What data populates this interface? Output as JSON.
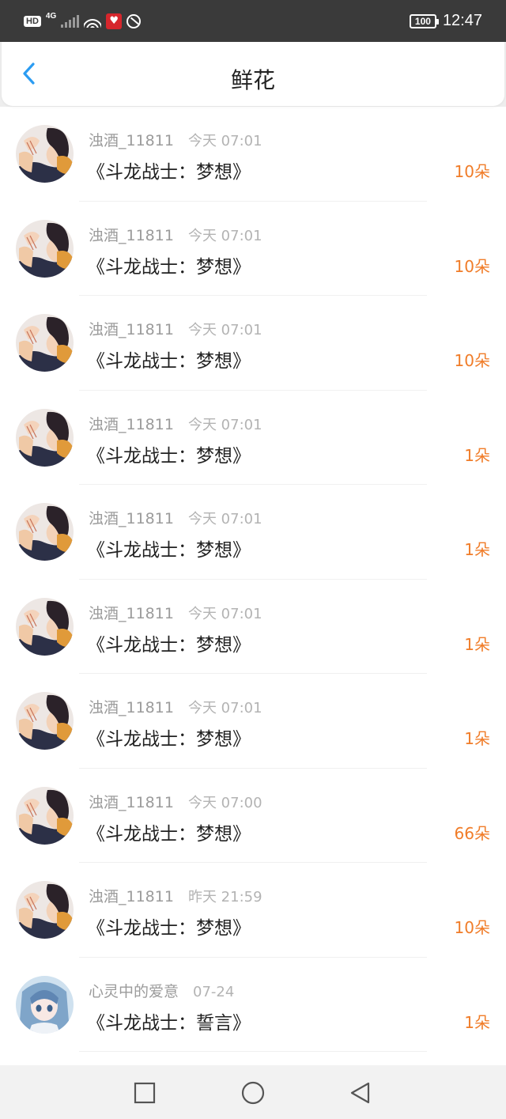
{
  "status_bar": {
    "hd": "HD",
    "network": "4G",
    "battery": "100",
    "time": "12:47",
    "icons": [
      "hd-icon",
      "signal-icon",
      "wifi-icon",
      "app-notification-icon",
      "sync-icon",
      "battery-icon"
    ]
  },
  "nav": {
    "title": "鲜花",
    "back_icon": "chevron-left-icon"
  },
  "colors": {
    "accent_blue": "#2b9cf2",
    "amount_orange": "#f07c28",
    "status_bar": "#3a3a3a"
  },
  "list": [
    {
      "user": "浊酒_11811",
      "time": "今天 07:01",
      "title": "《斗龙战士：梦想》",
      "amount": "10朵",
      "avatar": "avatar-boy"
    },
    {
      "user": "浊酒_11811",
      "time": "今天 07:01",
      "title": "《斗龙战士：梦想》",
      "amount": "10朵",
      "avatar": "avatar-boy"
    },
    {
      "user": "浊酒_11811",
      "time": "今天 07:01",
      "title": "《斗龙战士：梦想》",
      "amount": "10朵",
      "avatar": "avatar-boy"
    },
    {
      "user": "浊酒_11811",
      "time": "今天 07:01",
      "title": "《斗龙战士：梦想》",
      "amount": "1朵",
      "avatar": "avatar-boy"
    },
    {
      "user": "浊酒_11811",
      "time": "今天 07:01",
      "title": "《斗龙战士：梦想》",
      "amount": "1朵",
      "avatar": "avatar-boy"
    },
    {
      "user": "浊酒_11811",
      "time": "今天 07:01",
      "title": "《斗龙战士：梦想》",
      "amount": "1朵",
      "avatar": "avatar-boy"
    },
    {
      "user": "浊酒_11811",
      "time": "今天 07:01",
      "title": "《斗龙战士：梦想》",
      "amount": "1朵",
      "avatar": "avatar-boy"
    },
    {
      "user": "浊酒_11811",
      "time": "今天 07:00",
      "title": "《斗龙战士：梦想》",
      "amount": "66朵",
      "avatar": "avatar-boy"
    },
    {
      "user": "浊酒_11811",
      "time": "昨天 21:59",
      "title": "《斗龙战士：梦想》",
      "amount": "10朵",
      "avatar": "avatar-boy"
    },
    {
      "user": "心灵中的爱意",
      "time": "07-24",
      "title": "《斗龙战士：誓言》",
      "amount": "1朵",
      "avatar": "avatar-girl"
    }
  ],
  "system_nav": [
    "recents-square-icon",
    "home-circle-icon",
    "back-triangle-icon"
  ]
}
